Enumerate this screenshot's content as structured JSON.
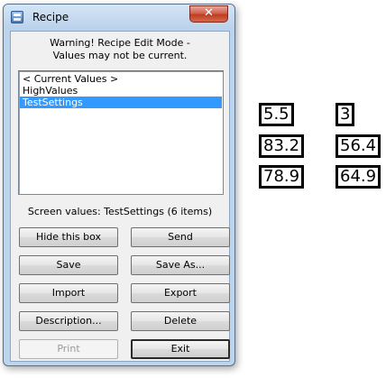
{
  "window": {
    "title": "Recipe",
    "close_glyph": "✕",
    "warning_line1": "Warning! Recipe Edit Mode -",
    "warning_line2": "Values may not be current."
  },
  "recipes": {
    "items": [
      {
        "label": "< Current Values >",
        "selected": false
      },
      {
        "label": "HighValues",
        "selected": false
      },
      {
        "label": "TestSettings",
        "selected": true
      }
    ]
  },
  "status_text": "Screen values: TestSettings (6 items)",
  "buttons": {
    "hide": "Hide this box",
    "send": "Send",
    "save": "Save",
    "save_as": "Save As...",
    "import": "Import",
    "export": "Export",
    "description": "Description...",
    "delete": "Delete",
    "print": "Print",
    "exit": "Exit"
  },
  "values": {
    "left": [
      "5.5",
      "83.2",
      "78.9"
    ],
    "right": [
      "3",
      "56.4",
      "64.9"
    ]
  },
  "colors": {
    "selection": "#3399ff",
    "close_button": "#c03c22"
  }
}
